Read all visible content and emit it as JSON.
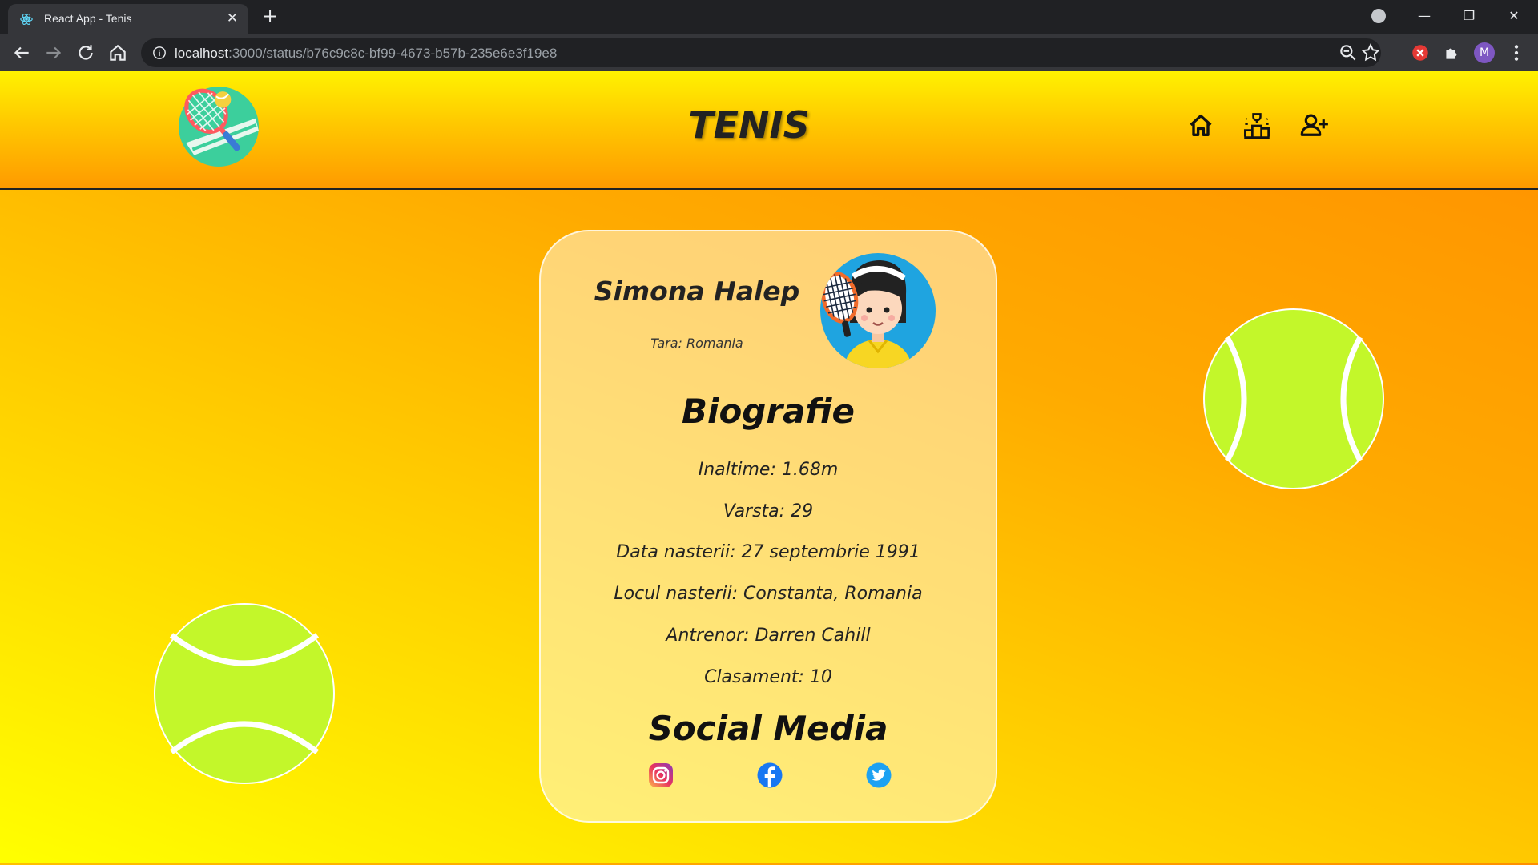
{
  "browser": {
    "tab_title": "React App - Tenis",
    "url_host": "localhost",
    "url_rest": ":3000/status/b76c9c8c-bf99-4673-b57b-235e6e3f19e8",
    "profile_initial": "M"
  },
  "header": {
    "brand": "TENIS",
    "nav": [
      "home-icon",
      "ranking-podium-icon",
      "add-user-icon"
    ]
  },
  "player": {
    "name": "Simona Halep",
    "country": "Tara: Romania",
    "biography_title": "Biografie",
    "bio": [
      "Inaltime: 1.68m",
      "Varsta: 29",
      "Data nasterii: 27 septembrie 1991",
      "Locul nasterii: Constanta, Romania",
      "Antrenor: Darren Cahill",
      "Clasament: 10"
    ],
    "social_title": "Social Media",
    "social": [
      "instagram-icon",
      "facebook-icon",
      "twitter-icon"
    ]
  },
  "colors": {
    "ball": "#c3f72a",
    "page_gradient_start": "#ffe400",
    "page_gradient_end": "#ff9000"
  }
}
